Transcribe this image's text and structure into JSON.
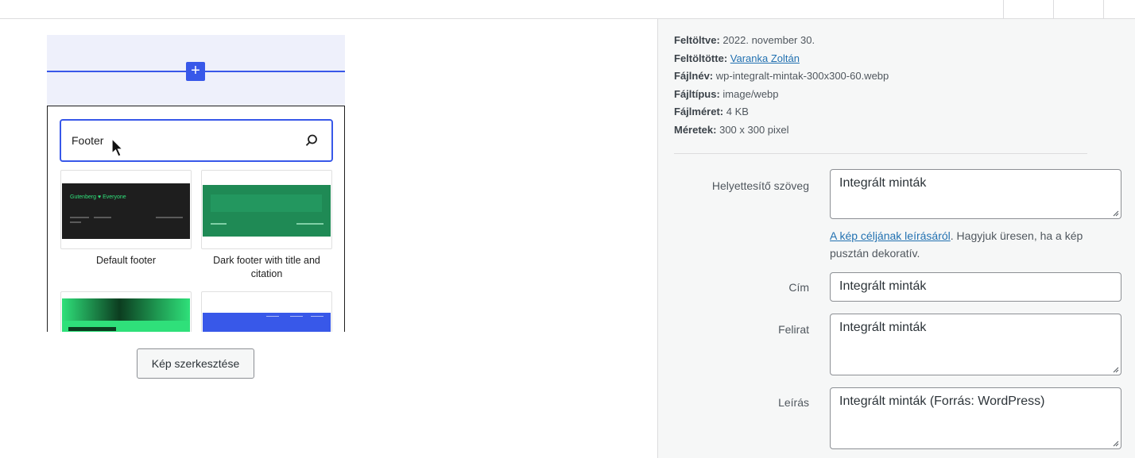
{
  "preview": {
    "plus_label": "+",
    "search_value": "Footer",
    "patterns": [
      {
        "name": "Default footer",
        "thumb_bg": "#1e1e1e",
        "thumb_text": "Gutenberg ♥ Everyone"
      },
      {
        "name": "Dark footer with title and citation",
        "thumb_bg": "#2a8c5c",
        "thumb_text": ""
      },
      {
        "name": "",
        "thumb_bg": "#2fe07a",
        "thumb_text": ""
      },
      {
        "name": "",
        "thumb_bg": "#3858e9",
        "thumb_text": ""
      }
    ]
  },
  "edit_button": "Kép szerkesztése",
  "details": {
    "uploaded_label": "Feltöltve:",
    "uploaded_value": "2022. november 30.",
    "uploader_label": "Feltöltötte:",
    "uploader_value": "Varanka Zoltán",
    "filename_label": "Fájlnév:",
    "filename_value": "wp-integralt-mintak-300x300-60.webp",
    "filetype_label": "Fájltípus:",
    "filetype_value": "image/webp",
    "filesize_label": "Fájlméret:",
    "filesize_value": "4 KB",
    "dimensions_label": "Méretek:",
    "dimensions_value": "300 x 300 pixel"
  },
  "form": {
    "alt_label": "Helyettesítő szöveg",
    "alt_value": "Integrált minták",
    "alt_help_link": "A kép céljának leírásáról",
    "alt_help_text": ". Hagyjuk üresen, ha a kép pusztán dekoratív.",
    "title_label": "Cím",
    "title_value": "Integrált minták",
    "caption_label": "Felirat",
    "caption_value": "Integrált minták",
    "description_label": "Leírás",
    "description_value": "Integrált minták (Forrás: WordPress)"
  },
  "colors": {
    "accent": "#3858e9",
    "link": "#2271b1"
  }
}
